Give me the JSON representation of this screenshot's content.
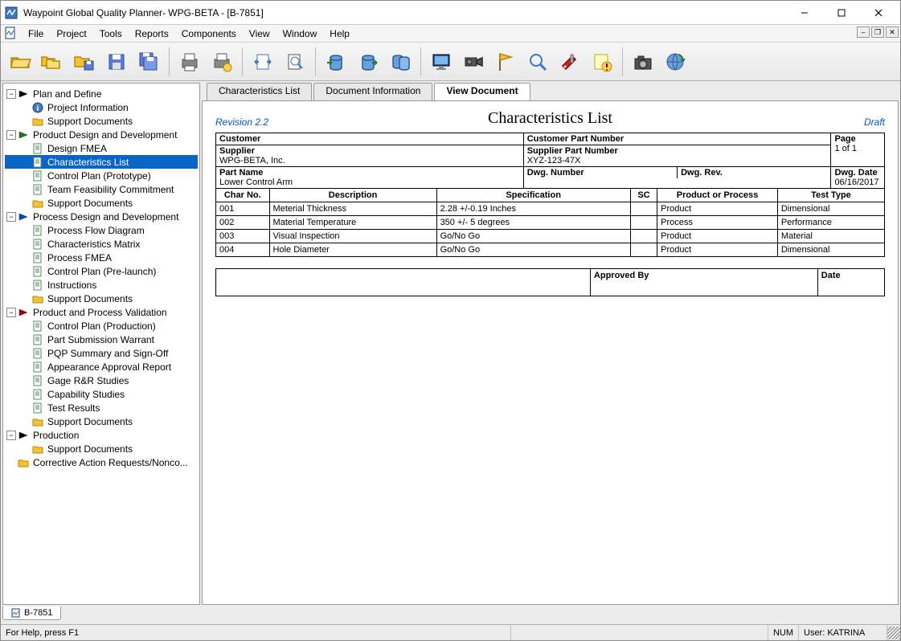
{
  "window": {
    "title": "Waypoint Global Quality Planner- WPG-BETA - [B-7851]"
  },
  "menu": [
    "File",
    "Project",
    "Tools",
    "Reports",
    "Components",
    "View",
    "Window",
    "Help"
  ],
  "tabs": {
    "items": [
      "Characteristics List",
      "Document Information",
      "View Document"
    ],
    "active_index": 2
  },
  "tree": {
    "selected": "Characteristics List",
    "groups": [
      {
        "label": "Plan and Define",
        "color": "#000",
        "children": [
          "Project Information",
          "Support Documents"
        ]
      },
      {
        "label": "Product Design and Development",
        "color": "#1a7a1a",
        "children": [
          "Design FMEA",
          "Characteristics List",
          "Control Plan (Prototype)",
          "Team Feasibility Commitment",
          "Support Documents"
        ]
      },
      {
        "label": "Process Design and Development",
        "color": "#0044cc",
        "children": [
          "Process Flow Diagram",
          "Characteristics Matrix",
          "Process FMEA",
          "Control Plan (Pre-launch)",
          "Instructions",
          "Support Documents"
        ]
      },
      {
        "label": "Product and Process Validation",
        "color": "#aa0000",
        "children": [
          "Control Plan (Production)",
          "Part Submission Warrant",
          "PQP Summary and Sign-Off",
          "Appearance Approval Report",
          "Gage R&R Studies",
          "Capability Studies",
          "Test Results",
          "Support Documents"
        ]
      },
      {
        "label": "Production",
        "color": "#000",
        "children": [
          "Support Documents"
        ]
      }
    ],
    "extra": "Corrective Action Requests/Nonco..."
  },
  "document": {
    "title": "Characteristics List",
    "revision": "Revision 2.2",
    "status": "Draft",
    "info": {
      "customer_lbl": "Customer",
      "customer": "",
      "cust_part_lbl": "Customer Part Number",
      "cust_part": "",
      "page_lbl": "Page",
      "page": "1 of 1",
      "supplier_lbl": "Supplier",
      "supplier": "WPG-BETA, Inc.",
      "supp_part_lbl": "Supplier Part Number",
      "supp_part": "XYZ-123-47X",
      "part_lbl": "Part Name",
      "part": "Lower Control Arm",
      "dwg_num_lbl": "Dwg. Number",
      "dwg_num": "",
      "dwg_rev_lbl": "Dwg. Rev.",
      "dwg_rev": "",
      "dwg_date_lbl": "Dwg. Date",
      "dwg_date": "06/16/2017"
    },
    "headers": [
      "Char No.",
      "Description",
      "Specification",
      "SC",
      "Product or Process",
      "Test Type"
    ],
    "rows": [
      {
        "no": "001",
        "desc": "Meterial Thickness",
        "spec": "2.28 +/-0.19 Inches",
        "sc": "",
        "pp": "Product",
        "tt": "Dimensional"
      },
      {
        "no": "002",
        "desc": "Material Temperature",
        "spec": "350 +/- 5 degrees",
        "sc": "",
        "pp": "Process",
        "tt": "Performance"
      },
      {
        "no": "003",
        "desc": "Visual Inspection",
        "spec": "Go/No Go",
        "sc": "",
        "pp": "Product",
        "tt": "Material"
      },
      {
        "no": "004",
        "desc": "Hole Diameter",
        "spec": "Go/No Go",
        "sc": "",
        "pp": "Product",
        "tt": "Dimensional"
      }
    ],
    "sig": {
      "blank": "",
      "approved_lbl": "Approved By",
      "date_lbl": "Date"
    }
  },
  "doc_tab": "B-7851",
  "status": {
    "help": "For Help, press F1",
    "num": "NUM",
    "user": "User: KATRINA"
  },
  "toolbar_names": [
    "open-folder",
    "open-multi",
    "save-folder",
    "save",
    "save-multi",
    "print",
    "print-config",
    "fit-width",
    "zoom",
    "db-left",
    "db-right",
    "db-both",
    "monitor",
    "camcorder",
    "flag",
    "find",
    "swiss-knife",
    "note-warning",
    "camera",
    "globe-refresh"
  ]
}
